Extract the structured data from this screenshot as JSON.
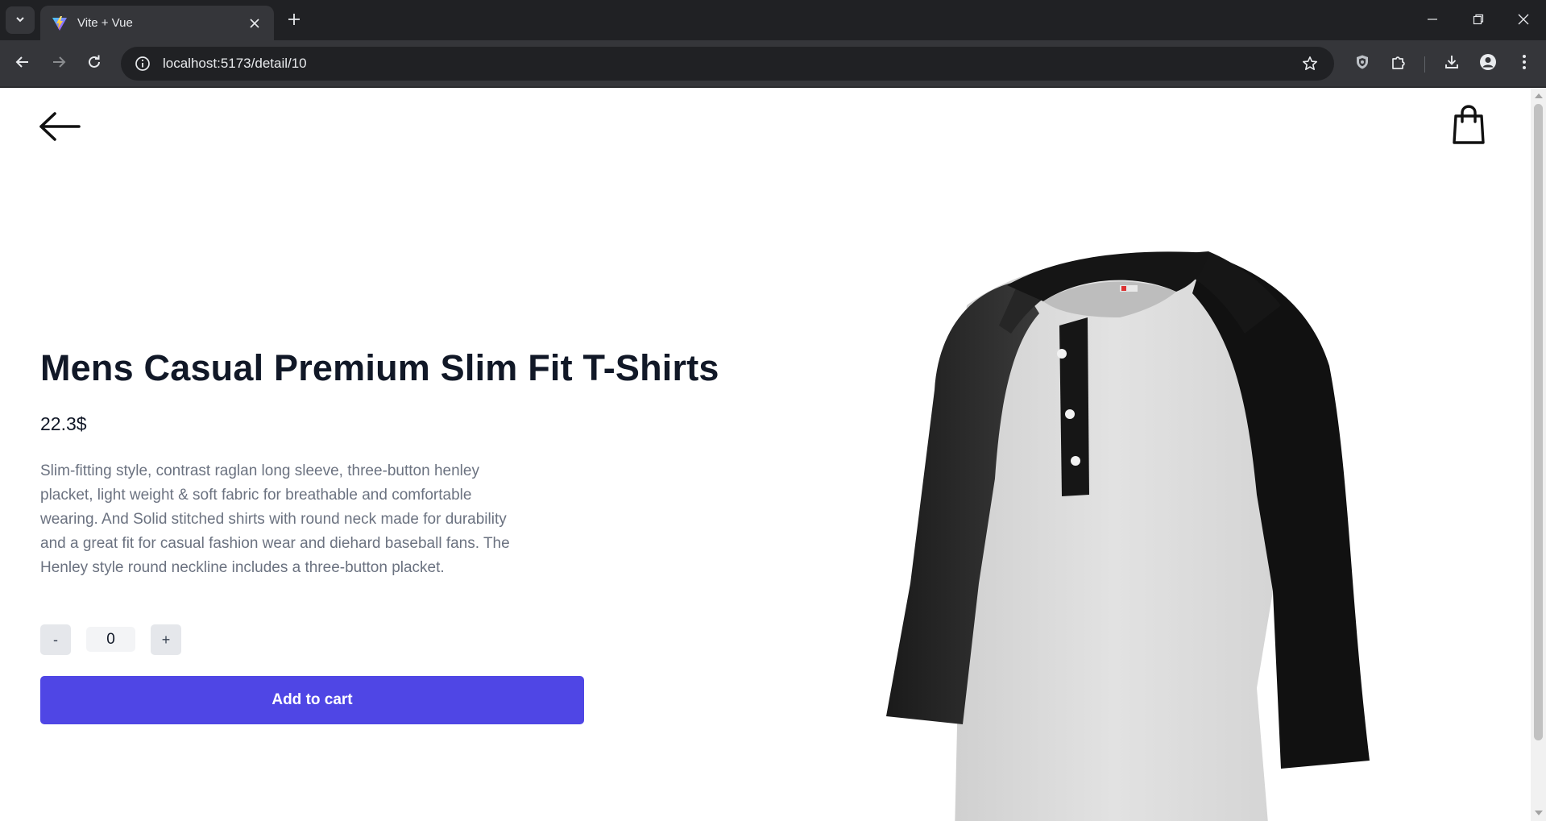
{
  "browser": {
    "tab_title": "Vite + Vue",
    "url": "localhost:5173/detail/10"
  },
  "icons": {
    "tab_search": "chevron-down-icon",
    "favicon": "vite-logo-icon",
    "tab_close": "close-icon",
    "new_tab": "plus-icon",
    "minimize": "minimize-icon",
    "restore": "restore-icon",
    "close_window": "close-icon",
    "back": "arrow-left-icon",
    "forward": "arrow-right-icon",
    "reload": "reload-icon",
    "site_info": "info-icon",
    "bookmark": "star-icon",
    "extension_shield": "shield-icon",
    "extensions": "puzzle-icon",
    "downloads": "download-icon",
    "profile": "person-icon",
    "menu": "more-vert-icon",
    "page_back": "arrow-left-icon",
    "cart": "shopping-bag-icon",
    "product": "henley-shirt-image"
  },
  "product": {
    "title": "Mens Casual Premium Slim Fit T-Shirts",
    "price": "22.3$",
    "description": "Slim-fitting style, contrast raglan long sleeve, three-button henley placket, light weight & soft fabric for breathable and comfortable wearing. And Solid stitched shirts with round neck made for durability and a great fit for casual fashion wear and diehard baseball fans. The Henley style round neckline includes a three-button placket."
  },
  "quantity": {
    "decrement_label": "-",
    "value": "0",
    "increment_label": "+"
  },
  "actions": {
    "add_to_cart_label": "Add to cart"
  },
  "colors": {
    "accent": "#4f46e5",
    "title": "#111827",
    "description": "#6b7280",
    "qty_bg": "#e5e7eb"
  }
}
